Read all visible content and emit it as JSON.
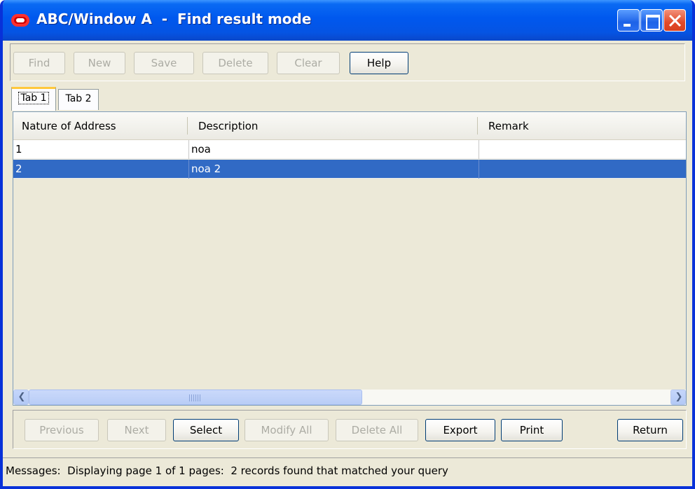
{
  "window": {
    "title": "ABC/Window A  -  Find result mode",
    "logo_icon": "oracle-logo-icon",
    "controls": [
      "minimize-icon",
      "maximize-icon",
      "close-icon"
    ]
  },
  "toolbar": {
    "find_label": "Find",
    "new_label": "New",
    "save_label": "Save",
    "delete_label": "Delete",
    "clear_label": "Clear",
    "help_label": "Help"
  },
  "tabs": [
    {
      "label": "Tab 1",
      "active": true
    },
    {
      "label": "Tab 2",
      "active": false
    }
  ],
  "table": {
    "columns": [
      "Nature of Address",
      "Description",
      "Remark"
    ],
    "rows": [
      {
        "nature": "1",
        "description": "noa",
        "remark": "",
        "selected": false
      },
      {
        "nature": "2",
        "description": "noa 2",
        "remark": "",
        "selected": true
      }
    ],
    "selection_color": "#316ac5"
  },
  "bottombar": {
    "previous_label": "Previous",
    "next_label": "Next",
    "select_label": "Select",
    "modify_all_label": "Modify All",
    "delete_all_label": "Delete All",
    "export_label": "Export",
    "print_label": "Print",
    "return_label": "Return"
  },
  "status": {
    "message": "Messages:  Displaying page 1 of 1 pages:  2 records found that matched your query"
  }
}
